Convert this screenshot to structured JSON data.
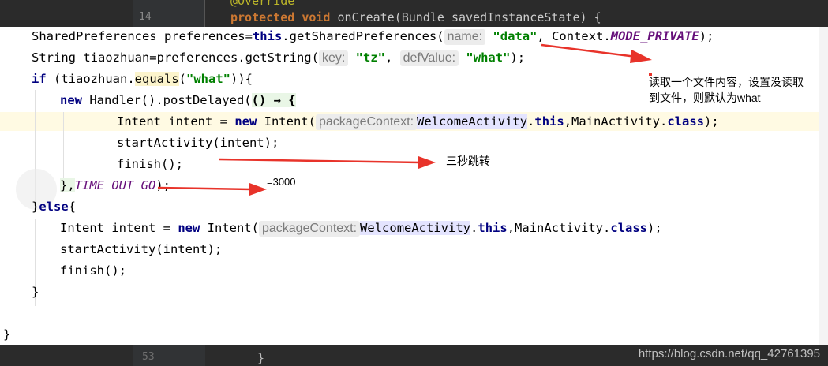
{
  "background_editor": {
    "top_line_1": "@Override",
    "top_line_number": "14",
    "top_keyword_1": "protected",
    "top_keyword_2": "void",
    "top_line_rest": " onCreate(Bundle savedInstanceState) {",
    "bottom_line_number": "53",
    "bottom_brace": "}",
    "watermark": "https://blog.csdn.net/qq_42761395"
  },
  "code": {
    "line1": {
      "a": "SharedPreferences preferences=",
      "kw": "this",
      "b": ".getSharedPreferences(",
      "hint1": "name:",
      "s1": "\"data\"",
      "c": ", Context.",
      "const": "MODE_PRIVATE",
      "d": ");"
    },
    "line2": {
      "a": "String tiaozhuan=preferences.getString(",
      "hint1": "key:",
      "s1": "\"tz\"",
      "c": ", ",
      "hint2": "defValue:",
      "s2": "\"what\"",
      "d": ");"
    },
    "line3": {
      "kw": "if",
      "a": " (tiaozhuan.",
      "method": "equals",
      "b": "(",
      "s1": "\"what\"",
      "c": ")){"
    },
    "line4": {
      "kw": "new",
      "a": " Handler().postDelayed(",
      "lambda": "() → {"
    },
    "line5": {
      "a": "Intent intent = ",
      "kw": "new",
      "b": " Intent(",
      "hint1": "packageContext:",
      "cls": "WelcomeActivity",
      "c": ".",
      "kw2": "this",
      "d": ",MainActivity.",
      "kw3": "class",
      "e": ");"
    },
    "line6": {
      "a": "startActivity(intent);"
    },
    "line7": {
      "a": "finish();"
    },
    "line8": {
      "a": "},",
      "const": "TIME_OUT_GO",
      "b": ");"
    },
    "line9": {
      "a": "}",
      "kw": "else",
      "b": "{"
    },
    "line10": {
      "a": "Intent intent = ",
      "kw": "new",
      "b": " Intent(",
      "hint1": "packageContext:",
      "cls": "WelcomeActivity",
      "c": ".",
      "kw2": "this",
      "d": ",MainActivity.",
      "kw3": "class",
      "e": ");"
    },
    "line11": {
      "a": "startActivity(intent);"
    },
    "line12": {
      "a": "finish();"
    },
    "line13": {
      "a": "}"
    },
    "line14": {
      "a": "}"
    }
  },
  "annotations": {
    "note1_line1": "读取一个文件内容，设置没读取",
    "note1_line2": "到文件，则默认为what",
    "note2": "三秒跳转",
    "note3": "=3000"
  },
  "colors": {
    "arrow": "#e8332a",
    "keyword": "#000080",
    "string": "#008000",
    "constant": "#660e7a"
  }
}
